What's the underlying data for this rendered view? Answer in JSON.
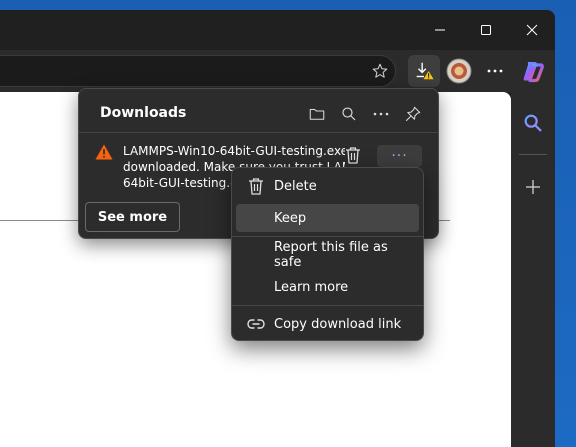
{
  "downloads": {
    "title": "Downloads",
    "item_text_line1": "LAMMPS-Win10-64bit-GUI-testing.exe is n",
    "item_text_line2": "downloaded. Make sure you trust LAMMPS",
    "item_text_line3": "64bit-GUI-testing.exe",
    "more_label": "···",
    "see_more_label": "See more"
  },
  "context_menu": {
    "items": [
      {
        "label": "Delete",
        "icon": "trash-icon"
      },
      {
        "label": "Keep",
        "icon": ""
      },
      {
        "label": "Report this file as safe",
        "icon": ""
      },
      {
        "label": "Learn more",
        "icon": ""
      },
      {
        "label": "Copy download link",
        "icon": "link-icon"
      }
    ],
    "hovered": "Keep"
  },
  "icons": {
    "caption": [
      "minimize-icon",
      "maximize-icon",
      "close-icon"
    ],
    "toolbar": [
      "favorite-star-icon",
      "downloads-warning-icon",
      "profile-avatar",
      "more-icon",
      "copilot-icon"
    ],
    "flyout": [
      "open-folder-icon",
      "search-icon",
      "more-options-icon",
      "pin-icon"
    ],
    "sidebar": [
      "search-icon",
      "add-icon"
    ]
  },
  "colors": {
    "warning": "#f7630c",
    "accent_link": "#8ab4f8",
    "flyout_bg": "#2c2c2c",
    "desktop": "#1f63b8"
  }
}
